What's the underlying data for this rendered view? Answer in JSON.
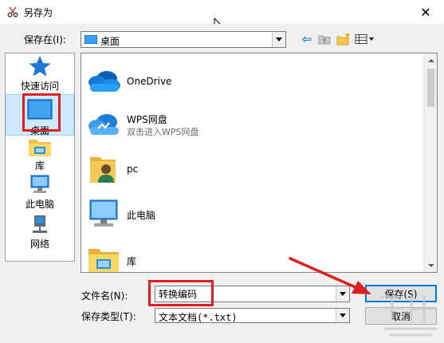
{
  "window": {
    "title": "另存为",
    "close_glyph": "✕"
  },
  "toolbar": {
    "look_in_label": "保存在(I):",
    "look_in_value": "桌面",
    "back_glyph": "⇦"
  },
  "places": [
    {
      "label": "快速访问",
      "icon": "star-icon"
    },
    {
      "label": "桌面",
      "icon": "desktop-icon"
    },
    {
      "label": "库",
      "icon": "library-icon"
    },
    {
      "label": "此电脑",
      "icon": "computer-icon"
    },
    {
      "label": "网络",
      "icon": "network-icon"
    }
  ],
  "files": [
    {
      "name": "OneDrive",
      "sub": "",
      "icon": "onedrive-cloud-icon"
    },
    {
      "name": "WPS网盘",
      "sub": "双击进入WPS网盘",
      "icon": "wps-cloud-icon"
    },
    {
      "name": "pc",
      "sub": "",
      "icon": "user-folder-icon"
    },
    {
      "name": "此电脑",
      "sub": "",
      "icon": "computer-icon"
    },
    {
      "name": "库",
      "sub": "",
      "icon": "library-folder-icon"
    }
  ],
  "form": {
    "filename_label": "文件名(N):",
    "filename_value": "转换编码",
    "filetype_label": "保存类型(T):",
    "filetype_value": "文本文档(*.txt)"
  },
  "buttons": {
    "save": "保存(S)",
    "cancel": "取消"
  },
  "colors": {
    "highlight": "#e02020",
    "accent": "#0078d7"
  }
}
